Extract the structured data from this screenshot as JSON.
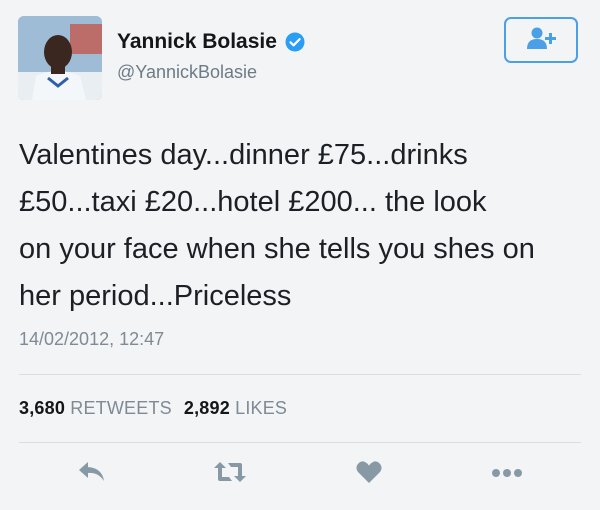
{
  "user": {
    "display_name": "Yannick Bolasie",
    "handle": "@YannickBolasie"
  },
  "tweet": {
    "lines": [
      "Valentines day...dinner £75...drinks",
      "£50...taxi £20...hotel £200... the look",
      "on your face when she tells you shes on",
      "her period...Priceless"
    ],
    "timestamp": "14/02/2012, 12:47"
  },
  "stats": {
    "retweets_count": "3,680",
    "retweets_label": "RETWEETS",
    "likes_count": "2,892",
    "likes_label": "LIKES"
  },
  "colors": {
    "accent": "#4a9fe6",
    "verified": "#2a9df4",
    "icon_gray": "#8899a6"
  },
  "icons": [
    "follow-add-user-icon",
    "verified-badge-icon",
    "reply-icon",
    "retweet-icon",
    "like-heart-icon",
    "more-options-icon"
  ]
}
